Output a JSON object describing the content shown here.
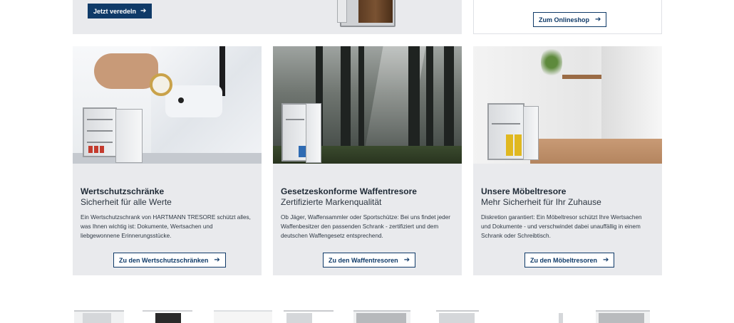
{
  "top": {
    "primary_button": "Jetzt veredeln",
    "shop_button": "Zum Onlineshop"
  },
  "cards": [
    {
      "title": "Wertschutzschränke",
      "subtitle": "Sicherheit für alle Werte",
      "description": "Ein Wertschutzschrank von HARTMANN TRESORE schützt alles, was Ihnen wichtig ist: Dokumente, Wertsachen und liebgewonnene Erinnerungsstücke.",
      "button": "Zu den Wertschutzschränken"
    },
    {
      "title": "Gesetzeskonforme Waffentresore",
      "subtitle": "Zertifizierte Markenqualität",
      "description": "Ob Jäger, Waffensammler oder Sportschütze: Bei uns findet jeder Waffenbesitzer den passenden Schrank - zertifiziert und dem deutschen Waffengesetz entsprechend.",
      "button": "Zu den Waffentresoren"
    },
    {
      "title": "Unsere Möbeltresore",
      "subtitle": "Mehr Sicherheit für Ihr Zuhause",
      "description": "Diskretion garantiert: Ein Möbeltresor schützt Ihre Wertsachen und Dokumente - und verschwindet dabei unauffällig in einem Schrank oder Schreibtisch.",
      "button": "Zu den Möbeltresoren"
    }
  ],
  "icons": {
    "arrow": "arrow-right-icon",
    "arrow_glyph": "➔"
  },
  "colors": {
    "brand_navy": "#0f3a68",
    "card_bg": "#e9eaed"
  }
}
